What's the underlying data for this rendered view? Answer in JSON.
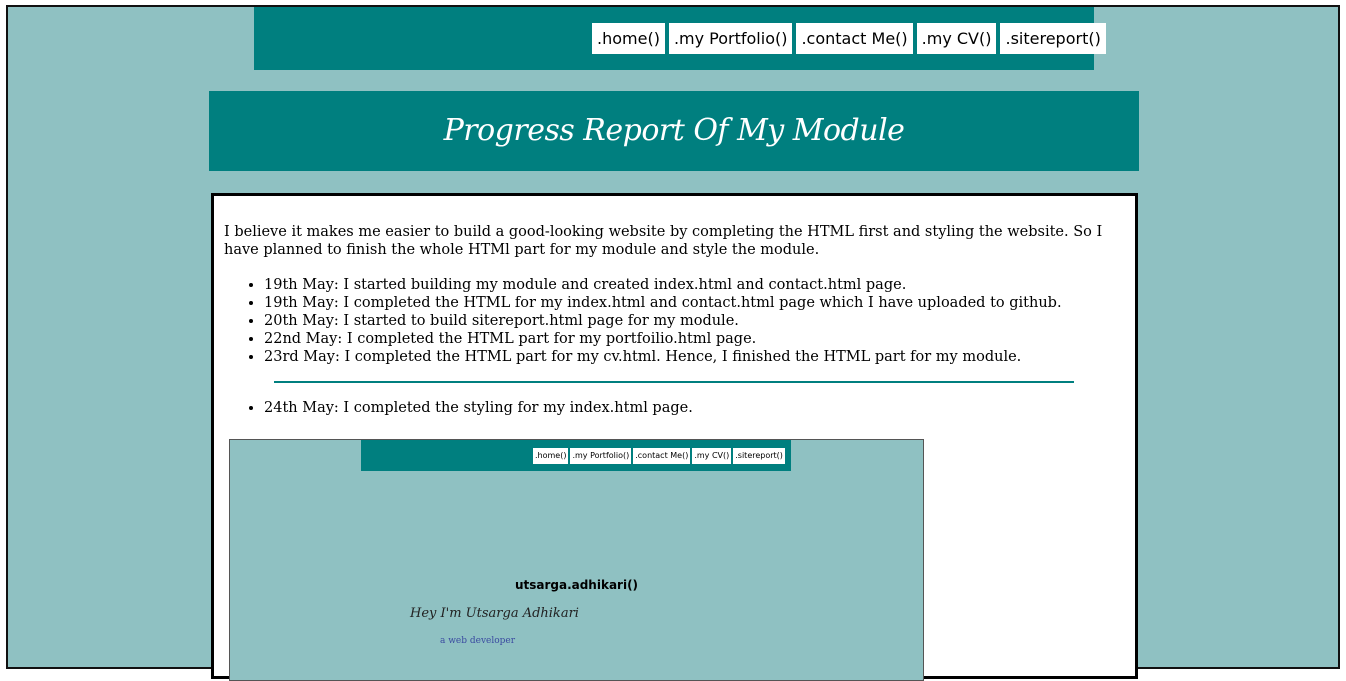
{
  "nav": {
    "items": [
      ".home()",
      ".my Portfolio()",
      ".contact Me()",
      ".my CV()",
      ".sitereport()"
    ]
  },
  "banner": {
    "title": "Progress Report Of My Module"
  },
  "content": {
    "intro": "I believe it makes me easier to build a good-looking website by completing the HTML first and styling the website. So I have planned to finish the whole HTMl part for my module and style the module.",
    "list1": [
      "19th May: I started building my module and created index.html and contact.html page.",
      "19th May: I completed the HTML for my index.html and contact.html page which I have uploaded to github.",
      "20th May: I started to build sitereport.html page for my module.",
      "22nd May: I completed the HTML part for my portfoilio.html page.",
      "23rd May: I completed the HTML part for my cv.html. Hence, I finished the HTML part for my module."
    ],
    "list2": [
      "24th May: I completed the styling for my index.html page."
    ]
  },
  "screenshot": {
    "nav_items": [
      ".home()",
      ".my Portfolio()",
      ".contact Me()",
      ".my CV()",
      ".sitereport()"
    ],
    "name": "utsarga.adhikari()",
    "greeting": "Hey I'm Utsarga Adhikari",
    "role": "a web developer"
  },
  "colors": {
    "teal": "#007f7f",
    "background": "#8fc1c2"
  }
}
